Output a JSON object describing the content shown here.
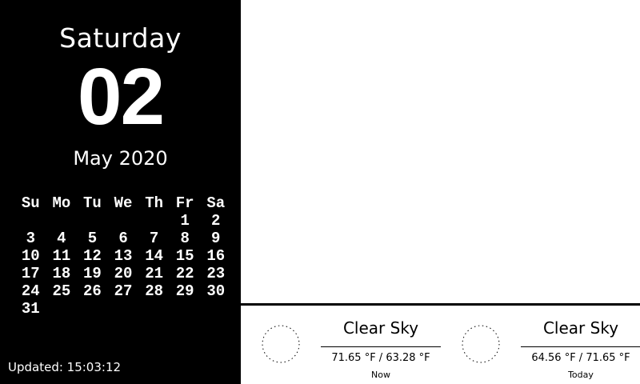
{
  "date": {
    "weekday": "Saturday",
    "day": "02",
    "month_year": "May 2020"
  },
  "calendar": {
    "headers": [
      "Su",
      "Mo",
      "Tu",
      "We",
      "Th",
      "Fr",
      "Sa"
    ],
    "weeks": [
      [
        "",
        "",
        "",
        "",
        "",
        "1",
        "2"
      ],
      [
        "3",
        "4",
        "5",
        "6",
        "7",
        "8",
        "9"
      ],
      [
        "10",
        "11",
        "12",
        "13",
        "14",
        "15",
        "16"
      ],
      [
        "17",
        "18",
        "19",
        "20",
        "21",
        "22",
        "23"
      ],
      [
        "24",
        "25",
        "26",
        "27",
        "28",
        "29",
        "30"
      ],
      [
        "31",
        "",
        "",
        "",
        "",
        "",
        ""
      ]
    ]
  },
  "updated": "Updated: 15:03:12",
  "weather": [
    {
      "condition": "Clear Sky",
      "temps": "71.65 °F / 63.28 °F",
      "label": "Now",
      "icon": "clear-sky-icon"
    },
    {
      "condition": "Clear Sky",
      "temps": "64.56 °F / 71.65 °F",
      "label": "Today",
      "icon": "clear-sky-icon"
    }
  ],
  "colors": {
    "panel": "#000000",
    "background": "#ffffff",
    "text_light": "#ffffff",
    "text_dark": "#000000"
  }
}
